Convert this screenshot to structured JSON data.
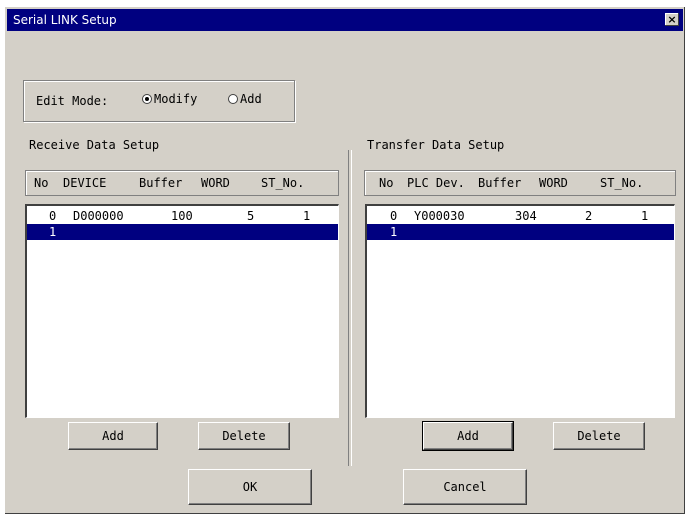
{
  "window": {
    "title": "Serial LINK Setup",
    "close_glyph": "×"
  },
  "edit_mode": {
    "label": "Edit Mode:",
    "options": [
      {
        "label": "Modify",
        "checked": true
      },
      {
        "label": "Add",
        "checked": false
      }
    ]
  },
  "receive": {
    "title": "Receive Data Setup",
    "columns": [
      "No",
      "DEVICE",
      "Buffer",
      "WORD",
      "ST_No."
    ],
    "rows": [
      {
        "no": "0",
        "device": "D000000",
        "buffer": "100",
        "word": "5",
        "st_no": "1"
      },
      {
        "no": "1",
        "device": "",
        "buffer": "",
        "word": "",
        "st_no": ""
      }
    ],
    "selected_row": 1,
    "add_label": "Add",
    "delete_label": "Delete"
  },
  "transfer": {
    "title": "Transfer Data Setup",
    "columns": [
      "No",
      "PLC Dev.",
      "Buffer",
      "WORD",
      "ST_No."
    ],
    "rows": [
      {
        "no": "0",
        "device": "Y000030",
        "buffer": "304",
        "word": "2",
        "st_no": "1"
      },
      {
        "no": "1",
        "device": "",
        "buffer": "",
        "word": "",
        "st_no": ""
      }
    ],
    "selected_row": 1,
    "add_label": "Add",
    "delete_label": "Delete"
  },
  "footer": {
    "ok_label": "OK",
    "cancel_label": "Cancel"
  },
  "colors": {
    "titlebar": "#000080",
    "face": "#d4d0c8",
    "selection": "#000080"
  }
}
